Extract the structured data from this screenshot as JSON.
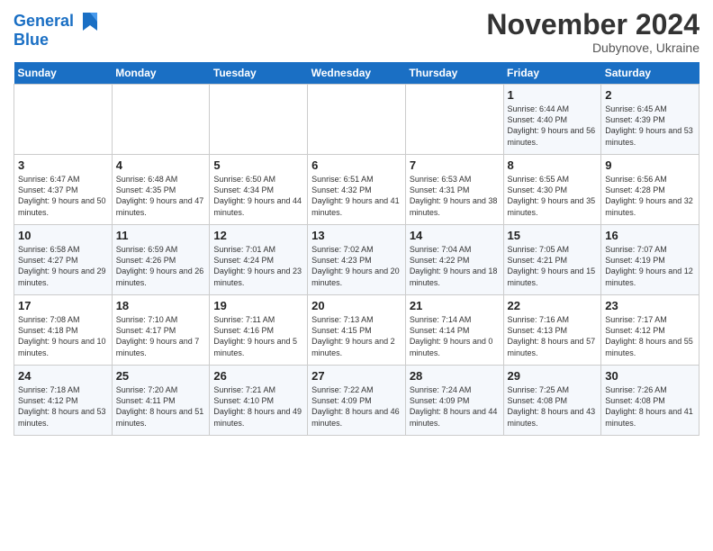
{
  "header": {
    "logo_line1": "General",
    "logo_line2": "Blue",
    "month_title": "November 2024",
    "location": "Dubynove, Ukraine"
  },
  "weekdays": [
    "Sunday",
    "Monday",
    "Tuesday",
    "Wednesday",
    "Thursday",
    "Friday",
    "Saturday"
  ],
  "weeks": [
    [
      {
        "day": "",
        "info": ""
      },
      {
        "day": "",
        "info": ""
      },
      {
        "day": "",
        "info": ""
      },
      {
        "day": "",
        "info": ""
      },
      {
        "day": "",
        "info": ""
      },
      {
        "day": "1",
        "info": "Sunrise: 6:44 AM\nSunset: 4:40 PM\nDaylight: 9 hours\nand 56 minutes."
      },
      {
        "day": "2",
        "info": "Sunrise: 6:45 AM\nSunset: 4:39 PM\nDaylight: 9 hours\nand 53 minutes."
      }
    ],
    [
      {
        "day": "3",
        "info": "Sunrise: 6:47 AM\nSunset: 4:37 PM\nDaylight: 9 hours\nand 50 minutes."
      },
      {
        "day": "4",
        "info": "Sunrise: 6:48 AM\nSunset: 4:35 PM\nDaylight: 9 hours\nand 47 minutes."
      },
      {
        "day": "5",
        "info": "Sunrise: 6:50 AM\nSunset: 4:34 PM\nDaylight: 9 hours\nand 44 minutes."
      },
      {
        "day": "6",
        "info": "Sunrise: 6:51 AM\nSunset: 4:32 PM\nDaylight: 9 hours\nand 41 minutes."
      },
      {
        "day": "7",
        "info": "Sunrise: 6:53 AM\nSunset: 4:31 PM\nDaylight: 9 hours\nand 38 minutes."
      },
      {
        "day": "8",
        "info": "Sunrise: 6:55 AM\nSunset: 4:30 PM\nDaylight: 9 hours\nand 35 minutes."
      },
      {
        "day": "9",
        "info": "Sunrise: 6:56 AM\nSunset: 4:28 PM\nDaylight: 9 hours\nand 32 minutes."
      }
    ],
    [
      {
        "day": "10",
        "info": "Sunrise: 6:58 AM\nSunset: 4:27 PM\nDaylight: 9 hours\nand 29 minutes."
      },
      {
        "day": "11",
        "info": "Sunrise: 6:59 AM\nSunset: 4:26 PM\nDaylight: 9 hours\nand 26 minutes."
      },
      {
        "day": "12",
        "info": "Sunrise: 7:01 AM\nSunset: 4:24 PM\nDaylight: 9 hours\nand 23 minutes."
      },
      {
        "day": "13",
        "info": "Sunrise: 7:02 AM\nSunset: 4:23 PM\nDaylight: 9 hours\nand 20 minutes."
      },
      {
        "day": "14",
        "info": "Sunrise: 7:04 AM\nSunset: 4:22 PM\nDaylight: 9 hours\nand 18 minutes."
      },
      {
        "day": "15",
        "info": "Sunrise: 7:05 AM\nSunset: 4:21 PM\nDaylight: 9 hours\nand 15 minutes."
      },
      {
        "day": "16",
        "info": "Sunrise: 7:07 AM\nSunset: 4:19 PM\nDaylight: 9 hours\nand 12 minutes."
      }
    ],
    [
      {
        "day": "17",
        "info": "Sunrise: 7:08 AM\nSunset: 4:18 PM\nDaylight: 9 hours\nand 10 minutes."
      },
      {
        "day": "18",
        "info": "Sunrise: 7:10 AM\nSunset: 4:17 PM\nDaylight: 9 hours\nand 7 minutes."
      },
      {
        "day": "19",
        "info": "Sunrise: 7:11 AM\nSunset: 4:16 PM\nDaylight: 9 hours\nand 5 minutes."
      },
      {
        "day": "20",
        "info": "Sunrise: 7:13 AM\nSunset: 4:15 PM\nDaylight: 9 hours\nand 2 minutes."
      },
      {
        "day": "21",
        "info": "Sunrise: 7:14 AM\nSunset: 4:14 PM\nDaylight: 9 hours\nand 0 minutes."
      },
      {
        "day": "22",
        "info": "Sunrise: 7:16 AM\nSunset: 4:13 PM\nDaylight: 8 hours\nand 57 minutes."
      },
      {
        "day": "23",
        "info": "Sunrise: 7:17 AM\nSunset: 4:12 PM\nDaylight: 8 hours\nand 55 minutes."
      }
    ],
    [
      {
        "day": "24",
        "info": "Sunrise: 7:18 AM\nSunset: 4:12 PM\nDaylight: 8 hours\nand 53 minutes."
      },
      {
        "day": "25",
        "info": "Sunrise: 7:20 AM\nSunset: 4:11 PM\nDaylight: 8 hours\nand 51 minutes."
      },
      {
        "day": "26",
        "info": "Sunrise: 7:21 AM\nSunset: 4:10 PM\nDaylight: 8 hours\nand 49 minutes."
      },
      {
        "day": "27",
        "info": "Sunrise: 7:22 AM\nSunset: 4:09 PM\nDaylight: 8 hours\nand 46 minutes."
      },
      {
        "day": "28",
        "info": "Sunrise: 7:24 AM\nSunset: 4:09 PM\nDaylight: 8 hours\nand 44 minutes."
      },
      {
        "day": "29",
        "info": "Sunrise: 7:25 AM\nSunset: 4:08 PM\nDaylight: 8 hours\nand 43 minutes."
      },
      {
        "day": "30",
        "info": "Sunrise: 7:26 AM\nSunset: 4:08 PM\nDaylight: 8 hours\nand 41 minutes."
      }
    ]
  ]
}
